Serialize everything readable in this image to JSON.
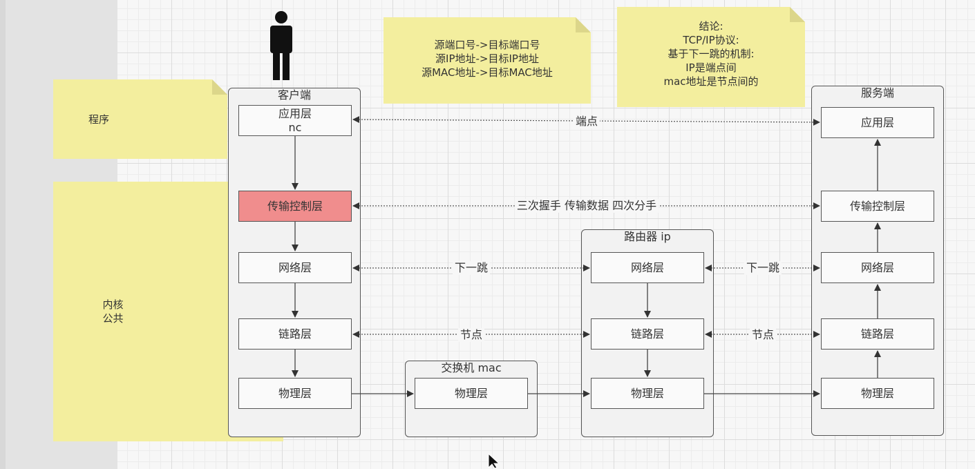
{
  "notes": {
    "program": "程序",
    "kernel": [
      "内核",
      "公共"
    ],
    "addresses": [
      "源端口号->目标端口号",
      "源IP地址->目标IP地址",
      "源MAC地址->目标MAC地址"
    ],
    "conclusion": [
      "结论:",
      "TCP/IP协议:",
      "基于下一跳的机制:",
      "IP是端点间",
      "mac地址是节点间的"
    ]
  },
  "client": {
    "title": "客户端",
    "app": [
      "应用层",
      "nc"
    ],
    "transport": "传输控制层",
    "network": "网络层",
    "link": "链路层",
    "physical": "物理层"
  },
  "switch": {
    "title": "交换机  mac",
    "physical": "物理层"
  },
  "router": {
    "title": "路由器  ip",
    "network": "网络层",
    "link": "链路层",
    "physical": "物理层"
  },
  "server": {
    "title": "服务端",
    "app": "应用层",
    "transport": "传输控制层",
    "network": "网络层",
    "link": "链路层",
    "physical": "物理层"
  },
  "edges": {
    "endpoint": "端点",
    "handshake": "三次握手 传输数据 四次分手",
    "next_hop_1": "下一跳",
    "next_hop_2": "下一跳",
    "node_1": "节点",
    "node_2": "节点"
  },
  "colors": {
    "note": "#f3ee9e",
    "highlight": "#f08d8d",
    "line": "#444444"
  }
}
